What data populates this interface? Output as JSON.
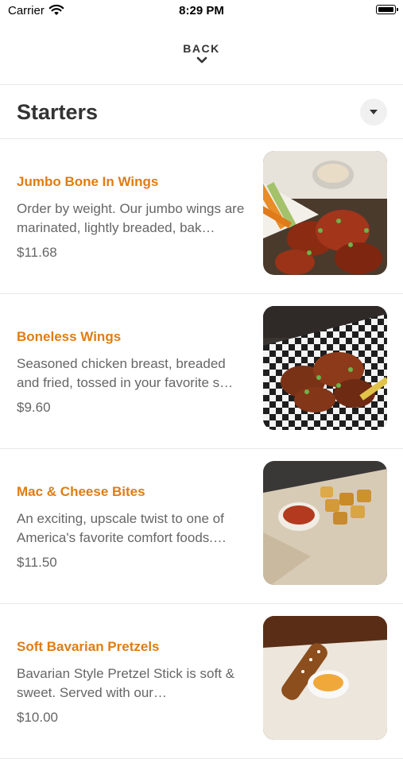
{
  "status_bar": {
    "carrier": "Carrier",
    "time": "8:29 PM"
  },
  "nav": {
    "back_label": "BACK"
  },
  "section": {
    "title": "Starters"
  },
  "items": [
    {
      "name": "Jumbo Bone In Wings",
      "description": "Order by weight.  Our jumbo wings are marinated, lightly breaded, bak…",
      "price": "$11.68",
      "photo": "wings-photo"
    },
    {
      "name": "Boneless Wings",
      "description": "Seasoned chicken breast, breaded and fried, tossed in your favorite s…",
      "price": "$9.60",
      "photo": "boneless-wings-photo"
    },
    {
      "name": "Mac & Cheese Bites",
      "description": "An exciting, upscale twist to one of America's favorite comfort foods.…",
      "price": "$11.50",
      "photo": "mac-cheese-bites-photo"
    },
    {
      "name": "Soft Bavarian Pretzels",
      "description": "Bavarian Style Pretzel Stick is soft & sweet.  Served with our…",
      "price": "$10.00",
      "photo": "pretzel-photo"
    }
  ],
  "colors": {
    "accent": "#e07c13",
    "text": "#333333",
    "muted": "#666666"
  }
}
